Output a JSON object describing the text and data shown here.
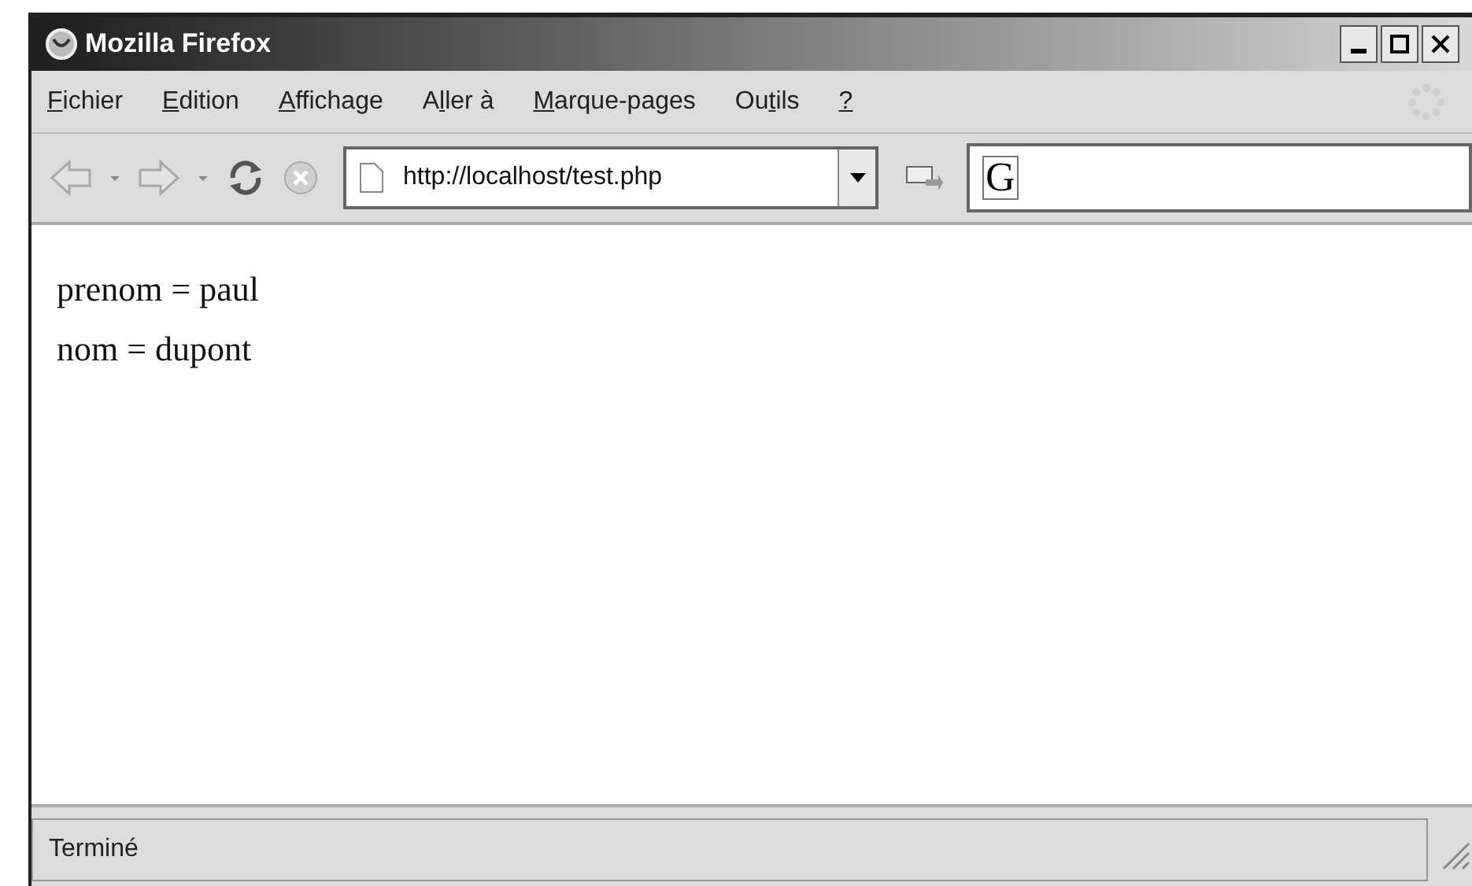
{
  "window": {
    "title": "Mozilla Firefox"
  },
  "menu": [
    {
      "key": "F",
      "after": "ichier"
    },
    {
      "key": "E",
      "after": "dition"
    },
    {
      "key": "A",
      "after": "ffichage"
    },
    {
      "before": "A",
      "key": "l",
      "after": "ler à"
    },
    {
      "key": "M",
      "after": "arque-pages"
    },
    {
      "before": "Ou",
      "key": "t",
      "after": "ils"
    },
    {
      "key": "?"
    }
  ],
  "toolbar": {
    "back_disabled": true,
    "forward_disabled": true,
    "stop_disabled": true,
    "address": "http://localhost/test.php",
    "search_letter": "G"
  },
  "content": {
    "lines": [
      "prenom = paul",
      "nom = dupont"
    ]
  },
  "status_bar": {
    "text": "Terminé"
  }
}
